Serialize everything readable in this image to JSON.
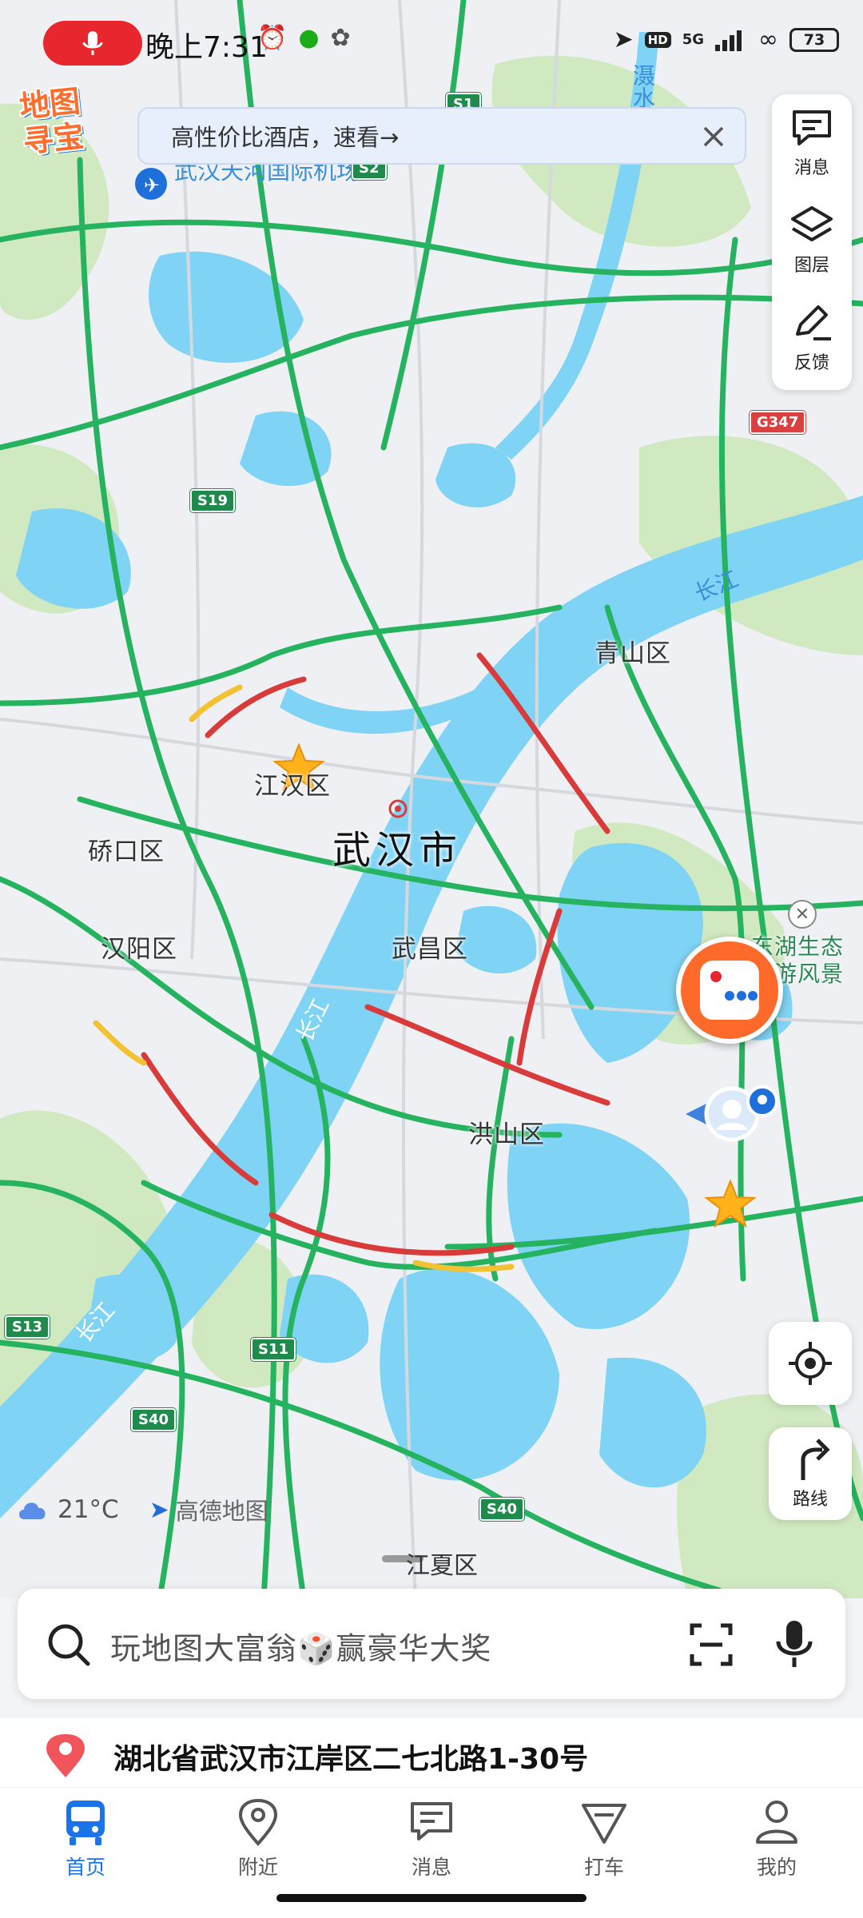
{
  "status_bar": {
    "time": "晚上7:31",
    "battery": "73",
    "network": "5G",
    "hd_badge": "HD"
  },
  "brand": {
    "logo_text_line1": "地图",
    "logo_text_line2": "寻宝"
  },
  "promo": {
    "text": "高性价比酒店，速看→"
  },
  "side_panel": [
    {
      "label": "消息",
      "icon": "message-icon"
    },
    {
      "label": "图层",
      "icon": "layers-icon"
    },
    {
      "label": "反馈",
      "icon": "feedback-icon"
    }
  ],
  "map": {
    "city": "武汉市",
    "airport": "武汉天河国际机场",
    "districts": {
      "qingshan": "青山区",
      "jianghan": "江汉区",
      "qiaokou": "硚口区",
      "hanyang": "汉阳区",
      "wuchang": "武昌区",
      "hongshan": "洪山区",
      "jiangxia": "江夏区",
      "scenic": "东湖生态旅游风景区"
    },
    "rivers": {
      "changjiang": "长江",
      "sheshui": "滠水",
      "changjiang_lower": "长江",
      "jiang_mid": "长江"
    },
    "highways": [
      "S1",
      "S2",
      "S19",
      "G347",
      "S13",
      "S11",
      "S40",
      "S40"
    ],
    "colors": {
      "water": "#7fd3f5",
      "green": "#cfe8bd",
      "road_green": "#25b35f",
      "road_red": "#d93a3a",
      "road_yellow": "#f2c233"
    }
  },
  "route_button": {
    "label": "路线"
  },
  "weather": {
    "temp": "21°C",
    "provider": "高德地图"
  },
  "search": {
    "placeholder": "玩地图大富翁🎲赢豪华大奖"
  },
  "location": {
    "address": "湖北省武汉市江岸区二七北路1-30号"
  },
  "tabs": [
    {
      "label": "首页",
      "icon": "bus-icon",
      "active": true
    },
    {
      "label": "附近",
      "icon": "pin-icon",
      "active": false
    },
    {
      "label": "消息",
      "icon": "message-icon",
      "active": false
    },
    {
      "label": "打车",
      "icon": "taxi-icon",
      "active": false
    },
    {
      "label": "我的",
      "icon": "user-icon",
      "active": false
    }
  ]
}
